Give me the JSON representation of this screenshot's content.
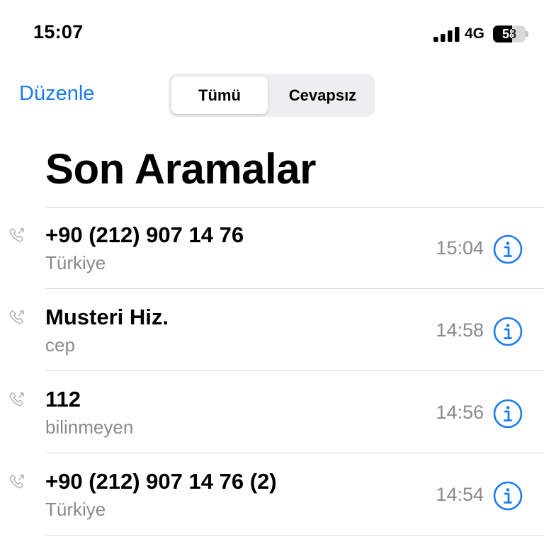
{
  "status_bar": {
    "time": "15:07",
    "network": "4G",
    "battery_level": "58",
    "battery_fraction": 0.58
  },
  "nav": {
    "edit_label": "Düzenle",
    "segments": [
      {
        "label": "Tümü",
        "selected": true
      },
      {
        "label": "Cevapsız",
        "selected": false
      }
    ]
  },
  "title": "Son Aramalar",
  "colors": {
    "accent": "#1a7cf0",
    "secondary_text": "#8a8a8e",
    "divider": "#d4d4d6"
  },
  "calls": [
    {
      "name": "+90 (212) 907 14 76",
      "detail": "Türkiye",
      "time": "15:04",
      "direction_icon": "outgoing-call-icon"
    },
    {
      "name": "Musteri Hiz.",
      "detail": "cep",
      "time": "14:58",
      "direction_icon": "outgoing-call-icon"
    },
    {
      "name": "112",
      "detail": "bilinmeyen",
      "time": "14:56",
      "direction_icon": "outgoing-call-icon"
    },
    {
      "name": "+90 (212) 907 14 76 (2)",
      "detail": "Türkiye",
      "time": "14:54",
      "direction_icon": "outgoing-call-icon"
    }
  ]
}
